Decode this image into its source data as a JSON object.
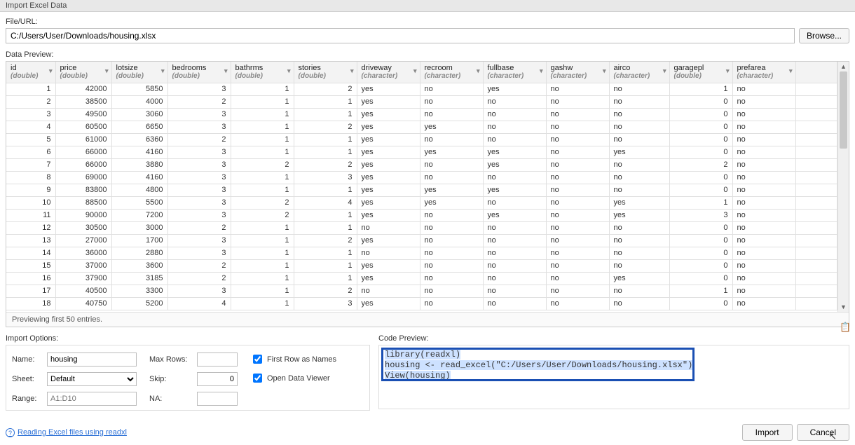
{
  "window": {
    "title": "Import Excel Data"
  },
  "file": {
    "label": "File/URL:",
    "value": "C:/Users/User/Downloads/housing.xlsx",
    "browse": "Browse..."
  },
  "preview": {
    "label": "Data Preview:",
    "footer": "Previewing first 50 entries.",
    "columns": [
      {
        "name": "id",
        "type": "(double)",
        "align": "num"
      },
      {
        "name": "price",
        "type": "(double)",
        "align": "num"
      },
      {
        "name": "lotsize",
        "type": "(double)",
        "align": "num"
      },
      {
        "name": "bedrooms",
        "type": "(double)",
        "align": "num"
      },
      {
        "name": "bathrms",
        "type": "(double)",
        "align": "num"
      },
      {
        "name": "stories",
        "type": "(double)",
        "align": "num"
      },
      {
        "name": "driveway",
        "type": "(character)",
        "align": "chr"
      },
      {
        "name": "recroom",
        "type": "(character)",
        "align": "chr"
      },
      {
        "name": "fullbase",
        "type": "(character)",
        "align": "chr"
      },
      {
        "name": "gashw",
        "type": "(character)",
        "align": "chr"
      },
      {
        "name": "airco",
        "type": "(character)",
        "align": "chr"
      },
      {
        "name": "garagepl",
        "type": "(double)",
        "align": "num"
      },
      {
        "name": "prefarea",
        "type": "(character)",
        "align": "chr"
      }
    ],
    "rows": [
      [
        1,
        42000,
        5850,
        3,
        1,
        2,
        "yes",
        "no",
        "yes",
        "no",
        "no",
        1,
        "no"
      ],
      [
        2,
        38500,
        4000,
        2,
        1,
        1,
        "yes",
        "no",
        "no",
        "no",
        "no",
        0,
        "no"
      ],
      [
        3,
        49500,
        3060,
        3,
        1,
        1,
        "yes",
        "no",
        "no",
        "no",
        "no",
        0,
        "no"
      ],
      [
        4,
        60500,
        6650,
        3,
        1,
        2,
        "yes",
        "yes",
        "no",
        "no",
        "no",
        0,
        "no"
      ],
      [
        5,
        61000,
        6360,
        2,
        1,
        1,
        "yes",
        "no",
        "no",
        "no",
        "no",
        0,
        "no"
      ],
      [
        6,
        66000,
        4160,
        3,
        1,
        1,
        "yes",
        "yes",
        "yes",
        "no",
        "yes",
        0,
        "no"
      ],
      [
        7,
        66000,
        3880,
        3,
        2,
        2,
        "yes",
        "no",
        "yes",
        "no",
        "no",
        2,
        "no"
      ],
      [
        8,
        69000,
        4160,
        3,
        1,
        3,
        "yes",
        "no",
        "no",
        "no",
        "no",
        0,
        "no"
      ],
      [
        9,
        83800,
        4800,
        3,
        1,
        1,
        "yes",
        "yes",
        "yes",
        "no",
        "no",
        0,
        "no"
      ],
      [
        10,
        88500,
        5500,
        3,
        2,
        4,
        "yes",
        "yes",
        "no",
        "no",
        "yes",
        1,
        "no"
      ],
      [
        11,
        90000,
        7200,
        3,
        2,
        1,
        "yes",
        "no",
        "yes",
        "no",
        "yes",
        3,
        "no"
      ],
      [
        12,
        30500,
        3000,
        2,
        1,
        1,
        "no",
        "no",
        "no",
        "no",
        "no",
        0,
        "no"
      ],
      [
        13,
        27000,
        1700,
        3,
        1,
        2,
        "yes",
        "no",
        "no",
        "no",
        "no",
        0,
        "no"
      ],
      [
        14,
        36000,
        2880,
        3,
        1,
        1,
        "no",
        "no",
        "no",
        "no",
        "no",
        0,
        "no"
      ],
      [
        15,
        37000,
        3600,
        2,
        1,
        1,
        "yes",
        "no",
        "no",
        "no",
        "no",
        0,
        "no"
      ],
      [
        16,
        37900,
        3185,
        2,
        1,
        1,
        "yes",
        "no",
        "no",
        "no",
        "yes",
        0,
        "no"
      ],
      [
        17,
        40500,
        3300,
        3,
        1,
        2,
        "no",
        "no",
        "no",
        "no",
        "no",
        1,
        "no"
      ],
      [
        18,
        40750,
        5200,
        4,
        1,
        3,
        "yes",
        "no",
        "no",
        "no",
        "no",
        0,
        "no"
      ]
    ]
  },
  "options": {
    "label": "Import Options:",
    "name_label": "Name:",
    "name_value": "housing",
    "sheet_label": "Sheet:",
    "sheet_value": "Default",
    "range_label": "Range:",
    "range_placeholder": "A1:D10",
    "maxrows_label": "Max Rows:",
    "maxrows_value": "",
    "skip_label": "Skip:",
    "skip_value": "0",
    "na_label": "NA:",
    "na_value": "",
    "first_row": "First Row as Names",
    "open_viewer": "Open Data Viewer"
  },
  "code": {
    "label": "Code Preview:",
    "line1": "library(readxl)",
    "line2a": "housing <- read_excel(",
    "line2b": "\"C:/Users/User/Downloads/housing.xlsx\"",
    "line2c": ")",
    "line3": "View(housing)"
  },
  "help": {
    "text": "Reading Excel files using readxl"
  },
  "buttons": {
    "import": "Import",
    "cancel": "Cancel"
  }
}
